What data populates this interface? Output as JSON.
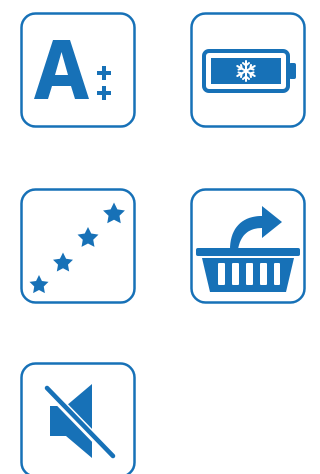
{
  "theme": {
    "accent": "#1771b7",
    "border": "#1771b7",
    "background": "#ffffff"
  },
  "icons": [
    {
      "name": "energy-rating-a-plus-plus-icon"
    },
    {
      "name": "battery-freeze-icon"
    },
    {
      "name": "rising-stars-icon"
    },
    {
      "name": "basket-export-icon"
    },
    {
      "name": "sound-muted-icon"
    }
  ]
}
